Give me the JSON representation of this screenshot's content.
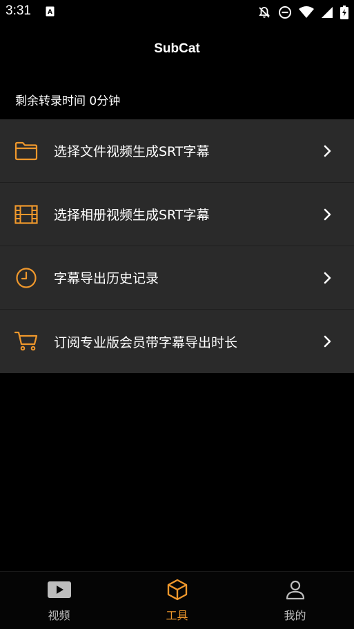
{
  "status_bar": {
    "time": "3:31",
    "icons": [
      "a-notification-icon",
      "bell-off-icon",
      "do-not-disturb-icon",
      "wifi-icon",
      "signal-icon",
      "battery-charging-icon"
    ]
  },
  "app": {
    "title": "SubCat"
  },
  "remaining": {
    "text": "剩余转录时间 0分钟"
  },
  "menu": {
    "items": [
      {
        "icon": "folder-icon",
        "label": "选择文件视频生成SRT字幕"
      },
      {
        "icon": "film-icon",
        "label": "选择相册视频生成SRT字幕"
      },
      {
        "icon": "clock-icon",
        "label": "字幕导出历史记录"
      },
      {
        "icon": "cart-icon",
        "label": "订阅专业版会员带字幕导出时长"
      }
    ]
  },
  "bottom_nav": {
    "tabs": [
      {
        "icon": "video-play-icon",
        "label": "视频",
        "active": false
      },
      {
        "icon": "toolbox-icon",
        "label": "工具",
        "active": true
      },
      {
        "icon": "user-icon",
        "label": "我的",
        "active": false
      }
    ]
  },
  "colors": {
    "accent": "#f0982c",
    "background": "#000000",
    "list_background": "#2a2a2a",
    "inactive_text": "#bdbdbd"
  }
}
